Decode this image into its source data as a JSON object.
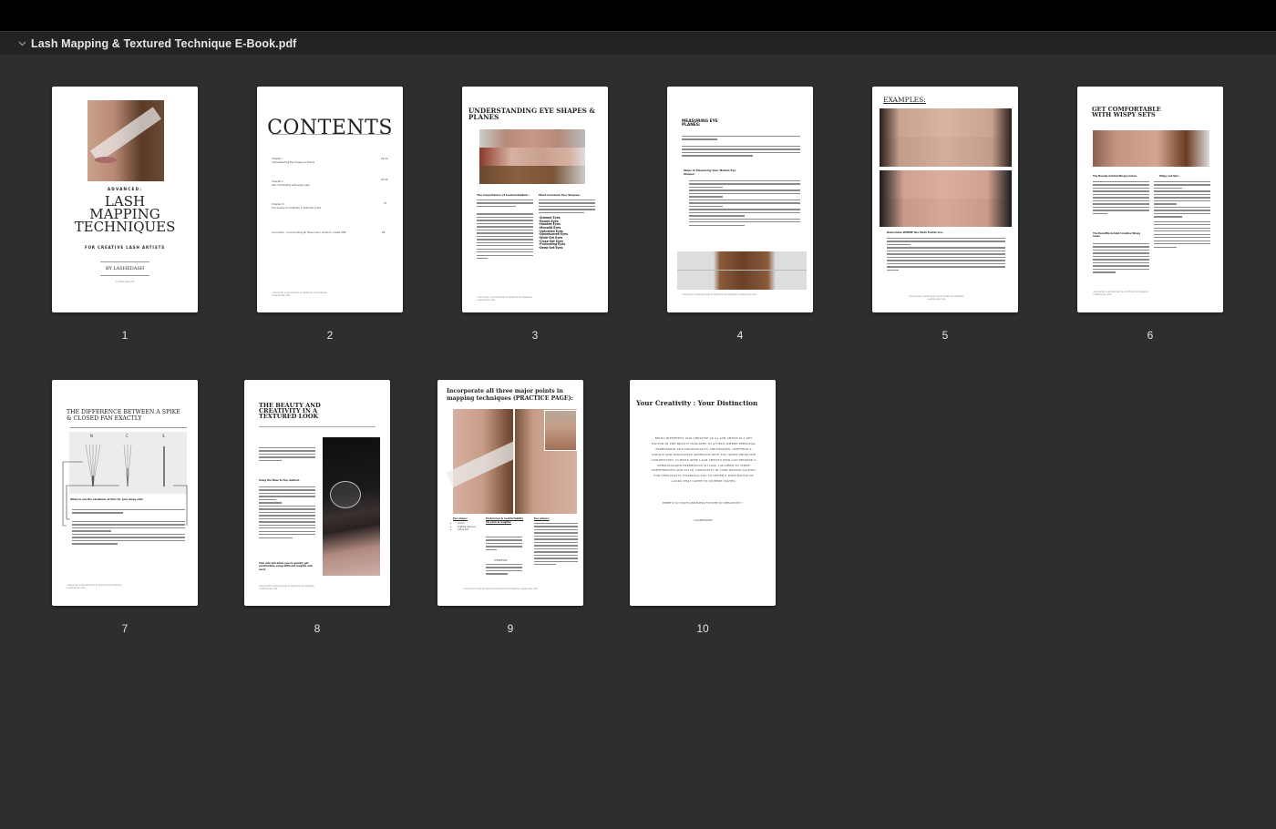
{
  "window": {
    "document_title": "Lash Mapping & Textured Technique E-Book.pdf",
    "disclosure_icon": "chevron-down-icon"
  },
  "pages": [
    {
      "number": "1",
      "advanced": "ADVANCED:",
      "title_lines": [
        "LASH",
        "MAPPING",
        "TECHNIQUES"
      ],
      "subtitle": "FOR CREATIVE LASH ARTISTS",
      "byline": "BY LASHEDASH",
      "site": "LASHEDASH.COM"
    },
    {
      "number": "2",
      "heading": "CONTENTS",
      "entries": [
        {
          "chapter": "Chapter I",
          "title": "Understanding Eye Shapes & Planes",
          "pages": "02-04"
        },
        {
          "chapter": "Chapter II",
          "title": "Get comfortable with wispy sets",
          "pages": "05-06"
        },
        {
          "chapter": "Chapter III",
          "title": "The beauty & Creativity in Textured Looks",
          "pages": "07"
        },
        {
          "chapter": "",
          "title": "Conclusion : Incorporating all three major points to create ONE",
          "pages": "08"
        }
      ],
      "footer": "ADVANCED LASH MAPPING & TEXTURE TECHNIQUES LASHEDASH.COM"
    },
    {
      "number": "3",
      "heading": "UNDERSTANDING EYE SHAPES & PLANES",
      "left_heading": "The Importance of Customization :",
      "left_intro": "Incorrect lash application based on eye shapes can lead to overwhelming or underemphasizing certain features.",
      "right_heading": "Most Common Eye Shapes:",
      "right_intro": "While there are countless eye shapes out there, there are a variety of COMMON shapes in which you'll encounter more than others. The most diverse and common eyes include:",
      "eye_shapes": [
        "-Almond Eyes",
        "-Round Eyes",
        "-Hooded Eyes",
        "-Monolid Eyes",
        "-Upturned Eyes",
        "-Downturned Eyes",
        "-Wide-Set Eyes",
        "-Close-Set Eyes",
        "-Protruding Eyes",
        "-Deep-Set Eyes"
      ],
      "footer": "ADVANCED LASH MAPPING & TEXTURE TECHNIQUES LASHEDASH.COM"
    },
    {
      "number": "4",
      "heading": "MEASURING EYE PLANES:",
      "steps_heading": "Steps In Measuring Your Models Eye Shapes:",
      "steps": [
        "Client Consultation",
        "Measure Eye Width",
        "Measure Center point",
        "Consider special cases",
        "Review with client before proceeding"
      ],
      "footer": "ADVANCED LASH MAPPING & TEXTURE TECHNIQUES LASHEDASH.COM"
    },
    {
      "number": "5",
      "heading": "EXAMPLES:",
      "caption_heading": "Determine WHERE the Main Points are:",
      "points": [
        "-Red Dot",
        "-Pupil Plane",
        "-Angled Plane"
      ],
      "footer": "ADVANCED LASH MAPPING & TEXTURE TECHNIQUES LASHEDASH.COM"
    },
    {
      "number": "6",
      "heading": "GET COMFORTABLE WITH WISPY SETS",
      "left_heading": "The Beauty behind Wispy Lashes",
      "left_heading_2": "The Benefits behind Creative Wispy looks",
      "right_heading": "Wispy set tips:",
      "footer": "ADVANCED LASH MAPPING & TEXTURE TECHNIQUES LASHEDASH.COM"
    },
    {
      "number": "7",
      "heading": "THE DIFFERENCE BETWEEN A SPIKE & CLOSED FAN EXACTLY",
      "fan_labels": [
        "N",
        "C",
        "S"
      ],
      "section_heading": "When to use the variations of fans for your wispy sets:",
      "bullets": [
        "Narrow Fans",
        "Closed Fans",
        "Spikes"
      ],
      "footer": "ADVANCED LASH MAPPING & TEXTURE TECHNIQUES LASHEDASH.COM"
    },
    {
      "number": "8",
      "heading": "THE BEAUTY AND CREATIVITY IN A TEXTURED LOOK",
      "method_heading": "Using the Base to Top method.",
      "closing": "This rule will allow you to quickly get comfortable using different lengths and curls.",
      "footer": "ADVANCED LASH MAPPING & TEXTURE TECHNIQUES LASHEDASH.COM"
    },
    {
      "number": "9",
      "heading": "Incorporate all three major points in mapping techniques (PRACTICE PAGE):",
      "col1_heading": "Eye shape:",
      "col1_items": [
        "round",
        "slightly almond",
        "Close set"
      ],
      "col2_heading": "Preference & Comfortability TO curls & lengths:",
      "col2_note": "THEREFORE",
      "col3_heading": "Eye planes:",
      "footer": "ADVANCED LASH MAPPING & TEXTURE TECHNIQUES LASHEDASH.COM"
    },
    {
      "number": "10",
      "heading": "Your Creativity : Your Distinction",
      "body": "BEING DIFFERENT AND CREATIVE AS A LASH ARTIST IS A KEY FACTOR IN THE BEAUTY INDUSTRY. IN A FIELD WHERE PERSONAL EXPRESSION AND INDIVIDUALITY ARE PRAISED, OFFERING A UNIQUE AND INNOVATIVE APPROACH SETS YOU APART FROM THE COMPETITION. CLIENTS SEEK LASH ARTISTS WHO CAN PROVIDE A PERSONALIZED EXPERIENCE & LOOK, TAILORED TO THEIR PREFERENCES AND STYLE. CREATIVITY IN LASH DESIGN ALLOWS FOR VERSATILITY, ENABLING YOU TO OFFER A WIDE RANGE OF LOOKS THAT CATER TO DIVERSE TASTES.",
      "cheers": "HERE'S TO YOUR LIMITLESS FUTURE IN CREATIVITY !",
      "signature": "-LASHEDASH"
    }
  ]
}
